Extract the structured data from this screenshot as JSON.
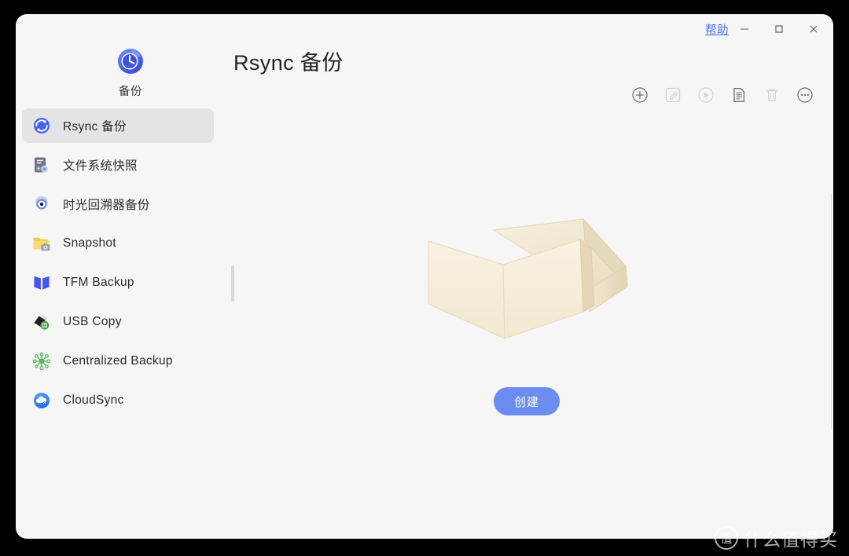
{
  "window": {
    "help_label": "帮助",
    "controls": {
      "minimize": "minimize-icon",
      "maximize": "maximize-icon",
      "close": "close-icon"
    }
  },
  "app": {
    "icon": "clock-backup-icon",
    "caption": "备份",
    "page_title": "Rsync 备份"
  },
  "toolbar": {
    "items": [
      {
        "name": "add-button",
        "icon": "plus-circle-icon",
        "enabled": true
      },
      {
        "name": "edit-button",
        "icon": "edit-square-icon",
        "enabled": false
      },
      {
        "name": "run-button",
        "icon": "play-circle-icon",
        "enabled": false
      },
      {
        "name": "log-button",
        "icon": "document-icon",
        "enabled": true
      },
      {
        "name": "delete-button",
        "icon": "trash-icon",
        "enabled": false
      },
      {
        "name": "more-button",
        "icon": "more-circle-icon",
        "enabled": true
      }
    ]
  },
  "sidebar": {
    "items": [
      {
        "label": "Rsync 备份",
        "icon": "rsync-sync-icon",
        "active": true
      },
      {
        "label": "文件系统快照",
        "icon": "filesystem-snapshot-icon",
        "active": false
      },
      {
        "label": "时光回溯器备份",
        "icon": "time-machine-icon",
        "active": false
      },
      {
        "label": "Snapshot",
        "icon": "folder-camera-icon",
        "active": false
      },
      {
        "label": "TFM Backup",
        "icon": "open-book-icon",
        "active": false
      },
      {
        "label": "USB Copy",
        "icon": "usb-drive-icon",
        "active": false
      },
      {
        "label": "Centralized Backup",
        "icon": "network-hub-icon",
        "active": false
      },
      {
        "label": "CloudSync",
        "icon": "cloud-sync-icon",
        "active": false
      }
    ]
  },
  "main": {
    "empty_illustration": "open-cardboard-box-illustration",
    "create_label": "创建"
  },
  "watermark": {
    "logo_text": "值",
    "text": "什么值得买"
  },
  "colors": {
    "window_bg": "#f6f6f6",
    "accent_blue": "#4c6ef5",
    "button_blue": "#6c8df0",
    "active_item_bg": "#e4e4e4",
    "text_primary": "#232323",
    "icon_enabled": "#6b6b6b",
    "icon_disabled": "#d2d2d2",
    "box_fill": "#f3e7cd"
  }
}
